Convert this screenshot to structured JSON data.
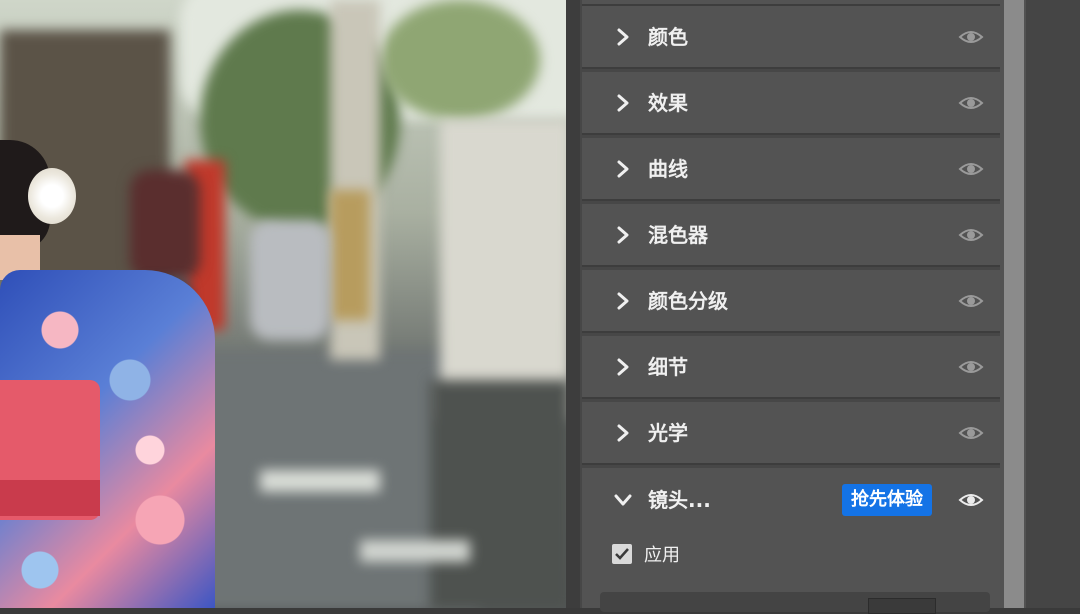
{
  "panel": {
    "sections": [
      {
        "label": "颜色",
        "expanded": false,
        "visible": true
      },
      {
        "label": "效果",
        "expanded": false,
        "visible": true
      },
      {
        "label": "曲线",
        "expanded": false,
        "visible": true
      },
      {
        "label": "混色器",
        "expanded": false,
        "visible": true
      },
      {
        "label": "颜色分级",
        "expanded": false,
        "visible": true
      },
      {
        "label": "细节",
        "expanded": false,
        "visible": true
      },
      {
        "label": "光学",
        "expanded": false,
        "visible": true
      }
    ],
    "lens": {
      "label": "镜头...",
      "badge": "抢先体验",
      "expanded": true,
      "apply_label": "应用",
      "apply_checked": true
    }
  },
  "colors": {
    "panel_bg": "#535353",
    "text": "#f0f0f0",
    "badge_bg": "#1473e6",
    "icon": "#bdbdbd"
  },
  "icons": {
    "collapsed": "chevron-right-icon",
    "expanded": "chevron-down-icon",
    "visibility": "eye-icon",
    "checkbox": "checkmark-icon"
  }
}
